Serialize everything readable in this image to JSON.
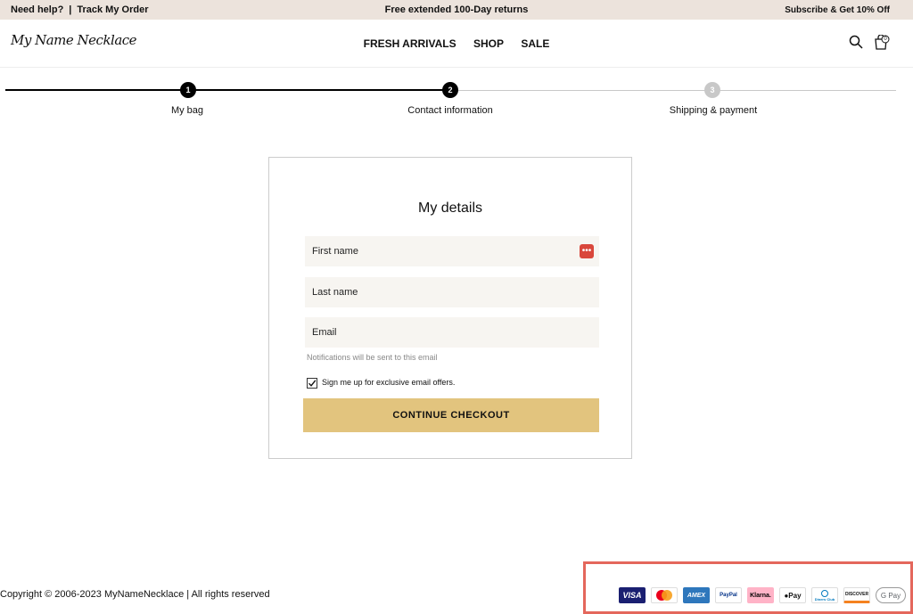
{
  "topbar": {
    "help": "Need help?",
    "divider": "|",
    "track": "Track My Order",
    "promo": "Free extended 100-Day returns",
    "subscribe": "Subscribe & Get 10% Off"
  },
  "header": {
    "logo": "My Name Necklace",
    "nav": [
      "FRESH ARRIVALS",
      "SHOP",
      "SALE"
    ],
    "cart_count": "0"
  },
  "steps": [
    {
      "num": "1",
      "label": "My bag",
      "state": "complete"
    },
    {
      "num": "2",
      "label": "Contact information",
      "state": "current"
    },
    {
      "num": "3",
      "label": "Shipping & payment",
      "state": "upcoming"
    }
  ],
  "form": {
    "title": "My details",
    "first_name_placeholder": "First name",
    "last_name_placeholder": "Last name",
    "email_placeholder": "Email",
    "email_hint": "Notifications will be sent to this email",
    "checkbox_checked": true,
    "checkbox_label": "Sign me up for exclusive email offers.",
    "button": "CONTINUE CHECKOUT",
    "kebab_glyph": "•••"
  },
  "footer": {
    "copyright": "Copyright © 2006-2023 MyNameNecklace | All rights reserved",
    "payments": [
      {
        "label": "VISA",
        "name": "visa",
        "bg": "#1a1f71",
        "fg": "#ffffff"
      },
      {
        "label": "",
        "name": "mastercard",
        "bg": "#ffffff",
        "fg": "#000000"
      },
      {
        "label": "AMEX",
        "name": "amex",
        "bg": "#2e77bc",
        "fg": "#ffffff"
      },
      {
        "label": "PayPal",
        "name": "paypal",
        "bg": "#ffffff",
        "fg": "#003087"
      },
      {
        "label": "Klarna.",
        "name": "klarna",
        "bg": "#ffb3c7",
        "fg": "#000000"
      },
      {
        "label": "Pay",
        "name": "apple-pay",
        "bg": "#ffffff",
        "fg": "#000000"
      },
      {
        "label": "Diners Club",
        "name": "diners-club",
        "bg": "#ffffff",
        "fg": "#0079be"
      },
      {
        "label": "DISCOVER",
        "name": "discover",
        "bg": "#ffffff",
        "fg": "#000000"
      },
      {
        "label": "G Pay",
        "name": "google-pay",
        "bg": "#ffffff",
        "fg": "#5f6368"
      }
    ]
  },
  "colors": {
    "topbar_bg": "#ece3dc",
    "button_bg": "#e2c47e",
    "step_active": "#000000",
    "step_inactive": "#c8c8c8",
    "highlight_border": "#e4675c"
  }
}
